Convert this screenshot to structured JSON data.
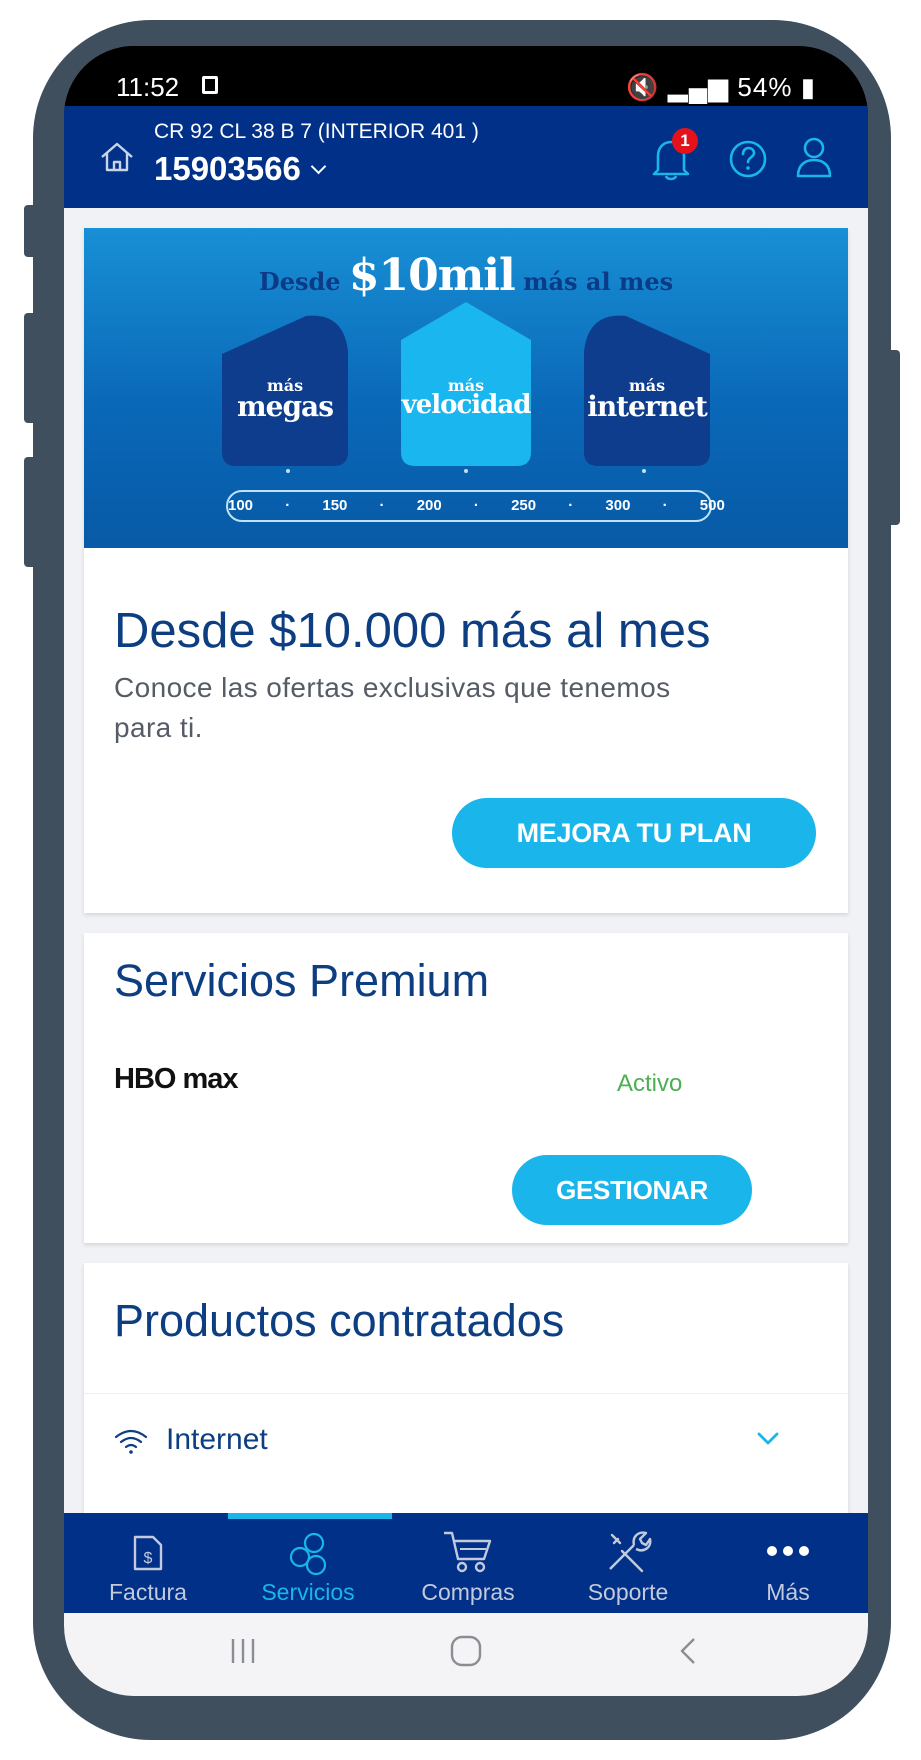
{
  "status_bar": {
    "time": "11:52",
    "battery": "54%",
    "icons": [
      "screenshot-icon",
      "mute-icon",
      "signal-icon",
      "wifi-icon",
      "battery-icon"
    ]
  },
  "header": {
    "address": "CR 92 CL 38 B  7 (INTERIOR 401 )",
    "account_number": "15903566",
    "notification_count": "1",
    "colors": {
      "background": "#003087",
      "badge": "#e3121b"
    }
  },
  "promo": {
    "banner": {
      "headline_prefix": "Desde",
      "headline_amount": "$10mil",
      "headline_suffix": "más al mes",
      "houses": [
        {
          "small": "más",
          "big": "megas"
        },
        {
          "small": "más",
          "big": "velocidad"
        },
        {
          "small": "más",
          "big": "internet"
        }
      ],
      "speeds": "100 · 150 · 200 · 250 · 300 · 500"
    },
    "title": "Desde $10.000 más al mes",
    "description": "Conoce las ofertas exclusivas que tenemos para ti.",
    "button_label": "MEJORA TU PLAN"
  },
  "premium": {
    "title": "Servicios Premium",
    "service_logo_text": "HBO max",
    "service_status": "Activo",
    "button_label": "GESTIONAR"
  },
  "products": {
    "title": "Productos contratados",
    "items": [
      {
        "label": "Internet",
        "icon": "wifi-icon"
      }
    ]
  },
  "bottom_nav": {
    "items": [
      {
        "label": "Factura",
        "icon": "invoice-icon"
      },
      {
        "label": "Servicios",
        "icon": "services-icon",
        "active": true
      },
      {
        "label": "Compras",
        "icon": "cart-icon"
      },
      {
        "label": "Soporte",
        "icon": "tools-icon"
      },
      {
        "label": "Más",
        "icon": "more-icon"
      }
    ],
    "colors": {
      "active": "#1ab5ea",
      "inactive": "#c2cadb"
    }
  },
  "system_nav": [
    "recent-apps-icon",
    "home-icon",
    "back-icon"
  ]
}
